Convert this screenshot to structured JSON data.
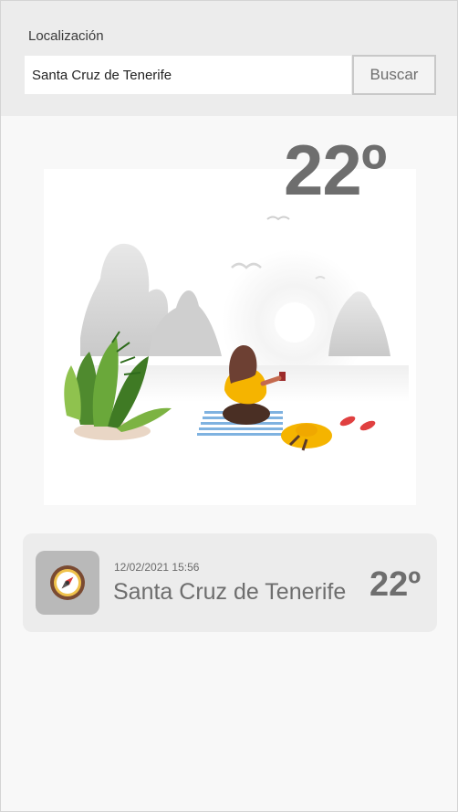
{
  "search": {
    "label": "Localización",
    "value": "Santa Cruz de Tenerife",
    "button": "Buscar"
  },
  "current": {
    "temperature": "22º",
    "illustration": "beach-illustration"
  },
  "history": [
    {
      "timestamp": "12/02/2021 15:56",
      "city": "Santa Cruz de Tenerife",
      "temperature": "22º",
      "icon": "compass-icon"
    }
  ]
}
